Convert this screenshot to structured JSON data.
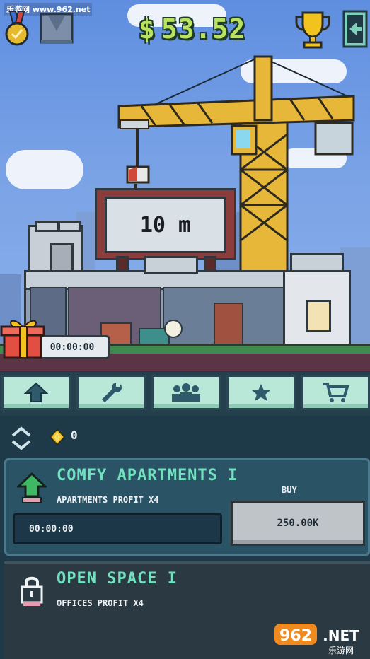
{
  "watermark": "乐游网 www.962.net",
  "hud": {
    "money": "53.52",
    "currency_symbol": "$"
  },
  "sign": {
    "height_label": "10 m"
  },
  "gift": {
    "timer": "00:00:00"
  },
  "toolbar": {
    "tabs": [
      {
        "name": "upgrades",
        "icon": "up-arrow-icon"
      },
      {
        "name": "tools",
        "icon": "wrench-icon"
      },
      {
        "name": "staff",
        "icon": "people-icon"
      },
      {
        "name": "stars",
        "icon": "star-icon"
      },
      {
        "name": "shop",
        "icon": "cart-icon"
      }
    ]
  },
  "panel": {
    "gems": "0",
    "upgrades": [
      {
        "title": "COMFY APARTMENTS I",
        "subtitle": "APARTMENTS PROFIT X4",
        "timer": "00:00:00",
        "buy_label": "BUY",
        "price": "250.00K",
        "icon": "up-arrow-icon"
      },
      {
        "title": "OPEN SPACE I",
        "subtitle": "OFFICES PROFIT X4",
        "icon": "lock-icon"
      }
    ]
  },
  "corner_logo": {
    "brand": "962",
    "suffix": ".NET",
    "tagline": "乐游网"
  },
  "colors": {
    "accent_green": "#b9e25e",
    "title_teal": "#73e0c0",
    "panel_bg": "#1e3a48",
    "sky": "#79a2e6"
  }
}
